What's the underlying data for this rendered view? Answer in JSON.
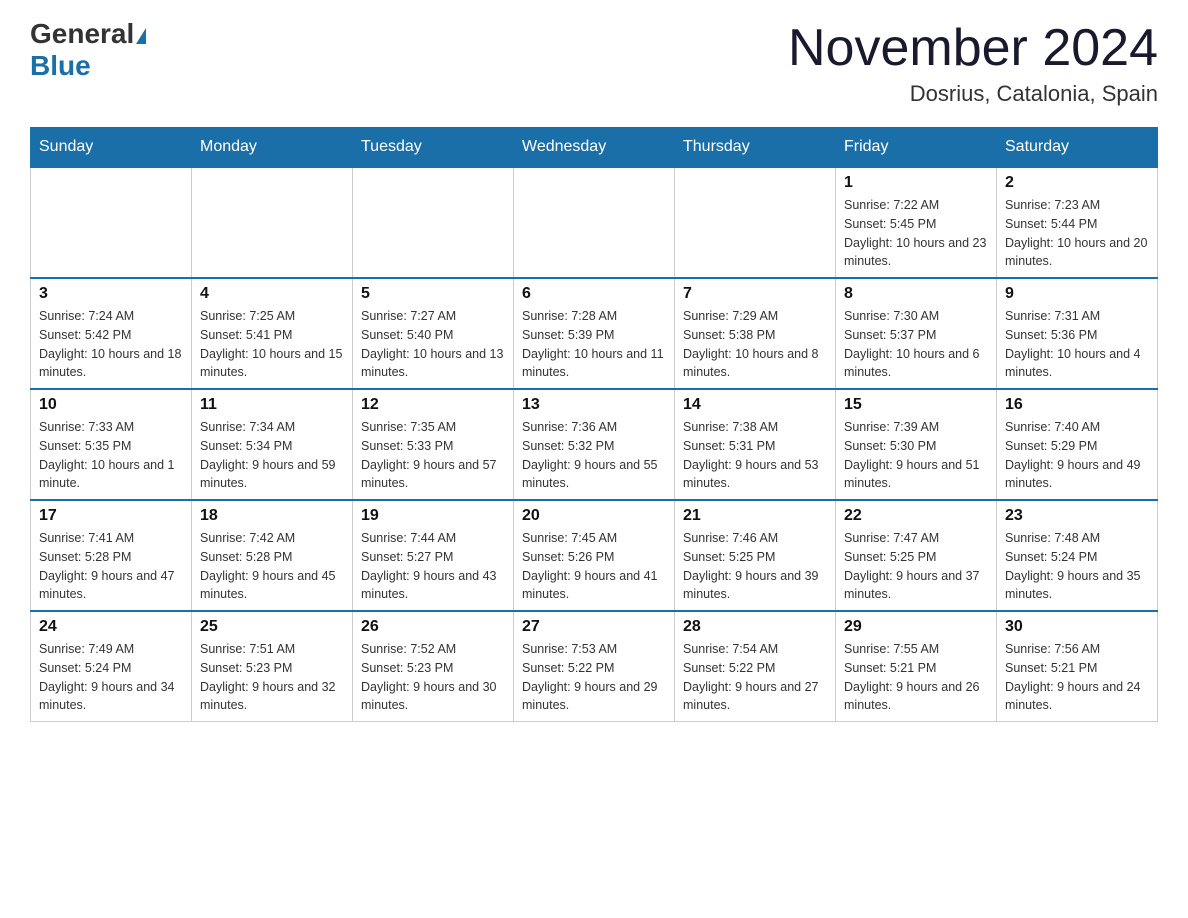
{
  "header": {
    "logo": {
      "general": "General",
      "blue": "Blue"
    },
    "title": "November 2024",
    "location": "Dosrius, Catalonia, Spain"
  },
  "weekdays": [
    "Sunday",
    "Monday",
    "Tuesday",
    "Wednesday",
    "Thursday",
    "Friday",
    "Saturday"
  ],
  "weeks": [
    [
      {
        "day": "",
        "info": ""
      },
      {
        "day": "",
        "info": ""
      },
      {
        "day": "",
        "info": ""
      },
      {
        "day": "",
        "info": ""
      },
      {
        "day": "",
        "info": ""
      },
      {
        "day": "1",
        "info": "Sunrise: 7:22 AM\nSunset: 5:45 PM\nDaylight: 10 hours and 23 minutes."
      },
      {
        "day": "2",
        "info": "Sunrise: 7:23 AM\nSunset: 5:44 PM\nDaylight: 10 hours and 20 minutes."
      }
    ],
    [
      {
        "day": "3",
        "info": "Sunrise: 7:24 AM\nSunset: 5:42 PM\nDaylight: 10 hours and 18 minutes."
      },
      {
        "day": "4",
        "info": "Sunrise: 7:25 AM\nSunset: 5:41 PM\nDaylight: 10 hours and 15 minutes."
      },
      {
        "day": "5",
        "info": "Sunrise: 7:27 AM\nSunset: 5:40 PM\nDaylight: 10 hours and 13 minutes."
      },
      {
        "day": "6",
        "info": "Sunrise: 7:28 AM\nSunset: 5:39 PM\nDaylight: 10 hours and 11 minutes."
      },
      {
        "day": "7",
        "info": "Sunrise: 7:29 AM\nSunset: 5:38 PM\nDaylight: 10 hours and 8 minutes."
      },
      {
        "day": "8",
        "info": "Sunrise: 7:30 AM\nSunset: 5:37 PM\nDaylight: 10 hours and 6 minutes."
      },
      {
        "day": "9",
        "info": "Sunrise: 7:31 AM\nSunset: 5:36 PM\nDaylight: 10 hours and 4 minutes."
      }
    ],
    [
      {
        "day": "10",
        "info": "Sunrise: 7:33 AM\nSunset: 5:35 PM\nDaylight: 10 hours and 1 minute."
      },
      {
        "day": "11",
        "info": "Sunrise: 7:34 AM\nSunset: 5:34 PM\nDaylight: 9 hours and 59 minutes."
      },
      {
        "day": "12",
        "info": "Sunrise: 7:35 AM\nSunset: 5:33 PM\nDaylight: 9 hours and 57 minutes."
      },
      {
        "day": "13",
        "info": "Sunrise: 7:36 AM\nSunset: 5:32 PM\nDaylight: 9 hours and 55 minutes."
      },
      {
        "day": "14",
        "info": "Sunrise: 7:38 AM\nSunset: 5:31 PM\nDaylight: 9 hours and 53 minutes."
      },
      {
        "day": "15",
        "info": "Sunrise: 7:39 AM\nSunset: 5:30 PM\nDaylight: 9 hours and 51 minutes."
      },
      {
        "day": "16",
        "info": "Sunrise: 7:40 AM\nSunset: 5:29 PM\nDaylight: 9 hours and 49 minutes."
      }
    ],
    [
      {
        "day": "17",
        "info": "Sunrise: 7:41 AM\nSunset: 5:28 PM\nDaylight: 9 hours and 47 minutes."
      },
      {
        "day": "18",
        "info": "Sunrise: 7:42 AM\nSunset: 5:28 PM\nDaylight: 9 hours and 45 minutes."
      },
      {
        "day": "19",
        "info": "Sunrise: 7:44 AM\nSunset: 5:27 PM\nDaylight: 9 hours and 43 minutes."
      },
      {
        "day": "20",
        "info": "Sunrise: 7:45 AM\nSunset: 5:26 PM\nDaylight: 9 hours and 41 minutes."
      },
      {
        "day": "21",
        "info": "Sunrise: 7:46 AM\nSunset: 5:25 PM\nDaylight: 9 hours and 39 minutes."
      },
      {
        "day": "22",
        "info": "Sunrise: 7:47 AM\nSunset: 5:25 PM\nDaylight: 9 hours and 37 minutes."
      },
      {
        "day": "23",
        "info": "Sunrise: 7:48 AM\nSunset: 5:24 PM\nDaylight: 9 hours and 35 minutes."
      }
    ],
    [
      {
        "day": "24",
        "info": "Sunrise: 7:49 AM\nSunset: 5:24 PM\nDaylight: 9 hours and 34 minutes."
      },
      {
        "day": "25",
        "info": "Sunrise: 7:51 AM\nSunset: 5:23 PM\nDaylight: 9 hours and 32 minutes."
      },
      {
        "day": "26",
        "info": "Sunrise: 7:52 AM\nSunset: 5:23 PM\nDaylight: 9 hours and 30 minutes."
      },
      {
        "day": "27",
        "info": "Sunrise: 7:53 AM\nSunset: 5:22 PM\nDaylight: 9 hours and 29 minutes."
      },
      {
        "day": "28",
        "info": "Sunrise: 7:54 AM\nSunset: 5:22 PM\nDaylight: 9 hours and 27 minutes."
      },
      {
        "day": "29",
        "info": "Sunrise: 7:55 AM\nSunset: 5:21 PM\nDaylight: 9 hours and 26 minutes."
      },
      {
        "day": "30",
        "info": "Sunrise: 7:56 AM\nSunset: 5:21 PM\nDaylight: 9 hours and 24 minutes."
      }
    ]
  ]
}
